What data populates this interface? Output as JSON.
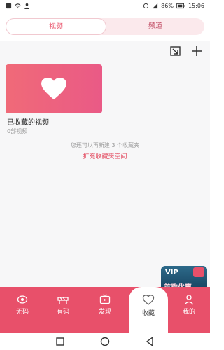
{
  "status_bar": {
    "left_icons": [
      "sim-icon",
      "wifi-icon",
      "person-icon"
    ],
    "battery": "86%",
    "time": "15:06"
  },
  "tabs": [
    {
      "label": "视频",
      "active": true
    },
    {
      "label": "频道",
      "active": false
    }
  ],
  "actions": {
    "import_icon": "import-icon",
    "add_icon": "plus-icon"
  },
  "favorites_card": {
    "title": "已收藏的视频",
    "count": "0部视频"
  },
  "hint": "您还可以再新建 3 个收藏夹",
  "expand_link": "扩充收藏夹空间",
  "vip": {
    "top": "VIP",
    "bottom": "首购优惠"
  },
  "bottom_nav": [
    {
      "label": "无码",
      "icon": "eye-icon"
    },
    {
      "label": "有码",
      "icon": "barrier-icon"
    },
    {
      "label": "发现",
      "icon": "tv-icon"
    },
    {
      "label": "收藏",
      "icon": "heart-icon",
      "active": true
    },
    {
      "label": "我的",
      "icon": "user-icon"
    }
  ],
  "colors": {
    "accent": "#e8506a",
    "accent_light": "#fbe9ec",
    "card_gradient_start": "#f06a78",
    "card_gradient_end": "#ea5a86"
  }
}
